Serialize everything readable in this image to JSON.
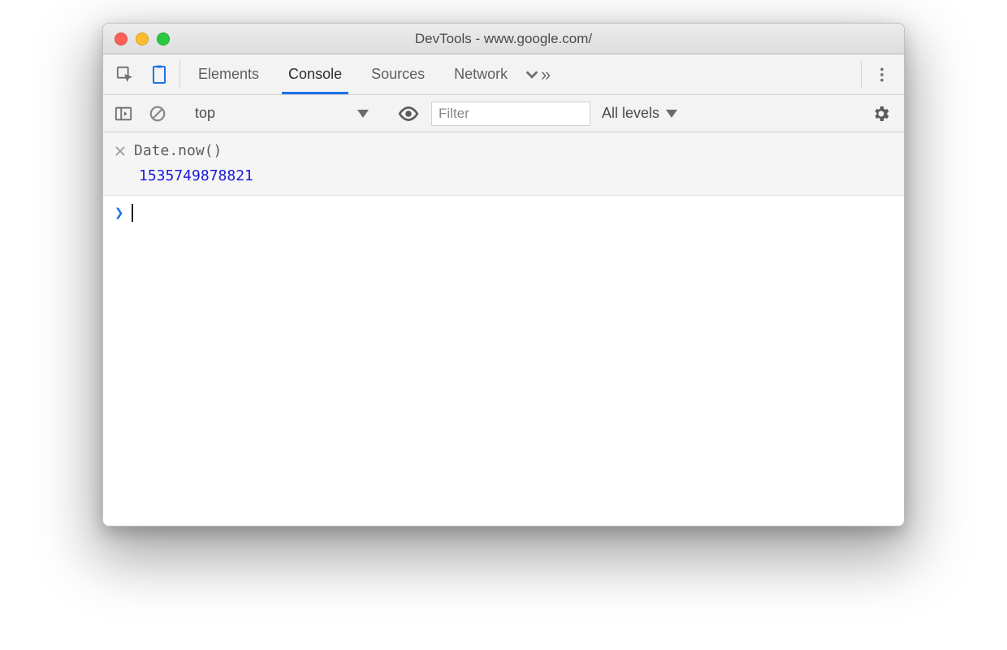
{
  "window": {
    "title": "DevTools - www.google.com/"
  },
  "tabs": {
    "elements": "Elements",
    "console": "Console",
    "sources": "Sources",
    "network": "Network"
  },
  "console_toolbar": {
    "context": "top",
    "filter_placeholder": "Filter",
    "levels": "All levels"
  },
  "console": {
    "history": [
      {
        "input": "Date.now()",
        "result": "1535749878821"
      }
    ]
  }
}
